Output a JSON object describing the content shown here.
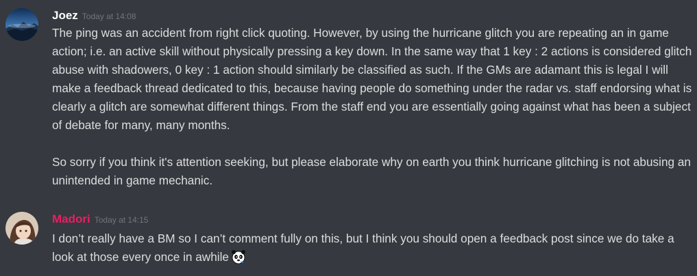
{
  "messages": [
    {
      "username": "Joez",
      "username_color": "#ffffff",
      "timestamp": "Today at 14:08",
      "avatar_icon": "mountain-landscape-avatar",
      "paragraphs": [
        "The ping was an accident from right click quoting. However, by using the hurricane glitch you are repeating an in game action; i.e. an active skill without physically pressing a key down. In the same way that 1 key : 2 actions is considered glitch abuse with shadowers, 0 key : 1 action should similarly be classified as such. If the GMs are adamant this is legal I will make a feedback thread dedicated to this, because having people do something under the radar vs. staff endorsing what is clearly a glitch are somewhat different things. From the staff end you are essentially going against what has been a subject of debate for many, many months.",
        "So sorry if you think it's attention seeking, but please elaborate why on earth you think hurricane glitching is not abusing an unintended in game mechanic."
      ]
    },
    {
      "username": "Madori",
      "username_color": "#e91e63",
      "timestamp": "Today at 14:15",
      "avatar_icon": "anime-girl-avatar",
      "paragraphs": [
        "I don’t really have a BM so I can’t comment fully on this, but I think you should open a feedback post since we do take a look at those every once in awhile"
      ],
      "emoji": "panda-thinking-emoji"
    }
  ],
  "colors": {
    "background": "#36393f",
    "text": "#dcddde",
    "timestamp": "#72767d"
  }
}
